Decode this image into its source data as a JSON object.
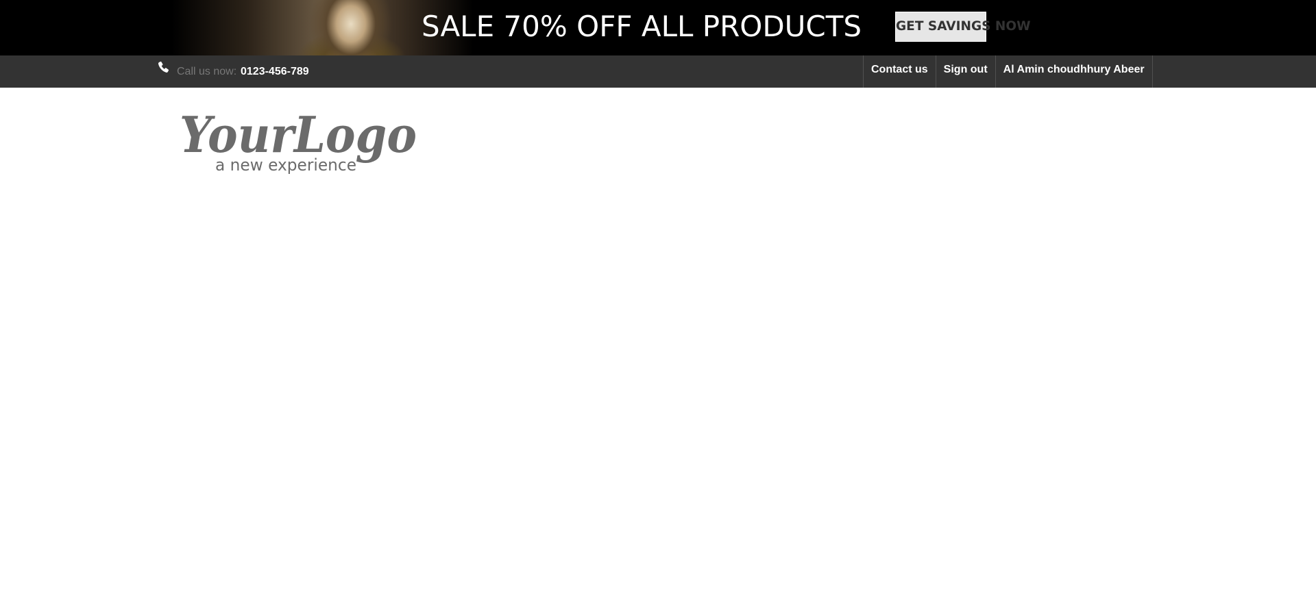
{
  "banner": {
    "headline": "SALE 70% OFF ALL PRODUCTS",
    "cta_label": "GET SAVINGS NOW"
  },
  "topbar": {
    "phone_icon": "phone-icon",
    "call_label": "Call us now:",
    "phone_number": "0123-456-789",
    "links": [
      {
        "label": "Contact us"
      },
      {
        "label": "Sign out"
      },
      {
        "label": "Al Amin choudhhury Abeer"
      }
    ]
  },
  "logo": {
    "main": "YourLogo",
    "tagline": "a new experience"
  },
  "colors": {
    "banner_bg": "#000000",
    "nav_bg": "#333333",
    "cta_bg": "#e6e6e6",
    "logo_gray": "#6b6b6b"
  }
}
